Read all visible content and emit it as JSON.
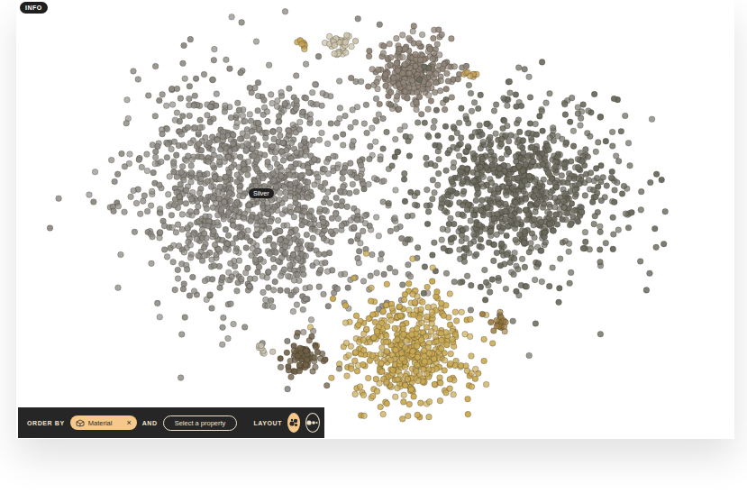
{
  "info_button": {
    "label": "INFO"
  },
  "tooltip": {
    "text": "Silver"
  },
  "clusters": [
    {
      "color": "#8c8982"
    },
    {
      "color": "#8e8377"
    },
    {
      "color": "#6c6b5f"
    },
    {
      "color": "#c9a952"
    },
    {
      "color": "#6f6047"
    },
    {
      "color": "#9c7c42"
    },
    {
      "color": "#cbc4ab"
    },
    {
      "color": "#c6a456"
    },
    {
      "color": "#c4a35a"
    },
    {
      "color": "#c9c3b0"
    }
  ],
  "toolbar": {
    "order_by_label": "ORDER BY",
    "primary": {
      "label": "Material",
      "clear": "×"
    },
    "and_label": "AND",
    "secondary": {
      "placeholder": "Select a property"
    },
    "layout_label": "LAYOUT",
    "layouts": [
      {
        "kind": "cluster",
        "selected": true
      },
      {
        "kind": "line",
        "selected": false
      }
    ]
  }
}
